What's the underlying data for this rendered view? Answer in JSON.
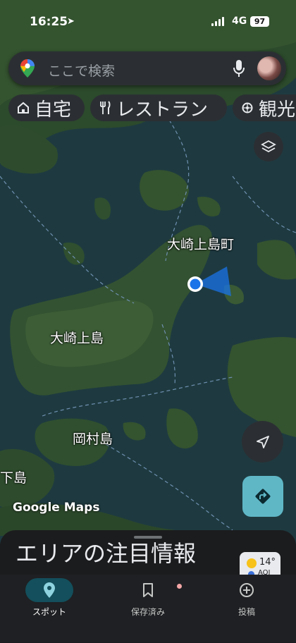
{
  "status_bar": {
    "time": "16:25",
    "network": "4G",
    "battery": "97"
  },
  "search": {
    "placeholder": "ここで検索"
  },
  "chips": [
    {
      "label": "自宅",
      "icon": "home-icon"
    },
    {
      "label": "レストラン",
      "icon": "restaurant-icon"
    },
    {
      "label": "観光",
      "icon": "attraction-icon"
    }
  ],
  "map_labels": {
    "town": "大崎上島町",
    "island_main": "大崎上島",
    "island_okamura": "岡村島",
    "island_edge": "下島",
    "watermark": "Google Maps"
  },
  "sheet": {
    "title": "エリアの注目情報"
  },
  "weather": {
    "temp": "14°",
    "aqi": "AQI"
  },
  "nav": [
    {
      "label": "スポット",
      "icon": "location-pin-icon",
      "active": true
    },
    {
      "label": "保存済み",
      "icon": "bookmark-icon",
      "active": false
    },
    {
      "label": "投稿",
      "icon": "add-circle-icon",
      "active": false
    }
  ],
  "colors": {
    "accent": "#5fb7c6",
    "active_nav": "#134f5c",
    "my_location": "#1a73e8"
  }
}
